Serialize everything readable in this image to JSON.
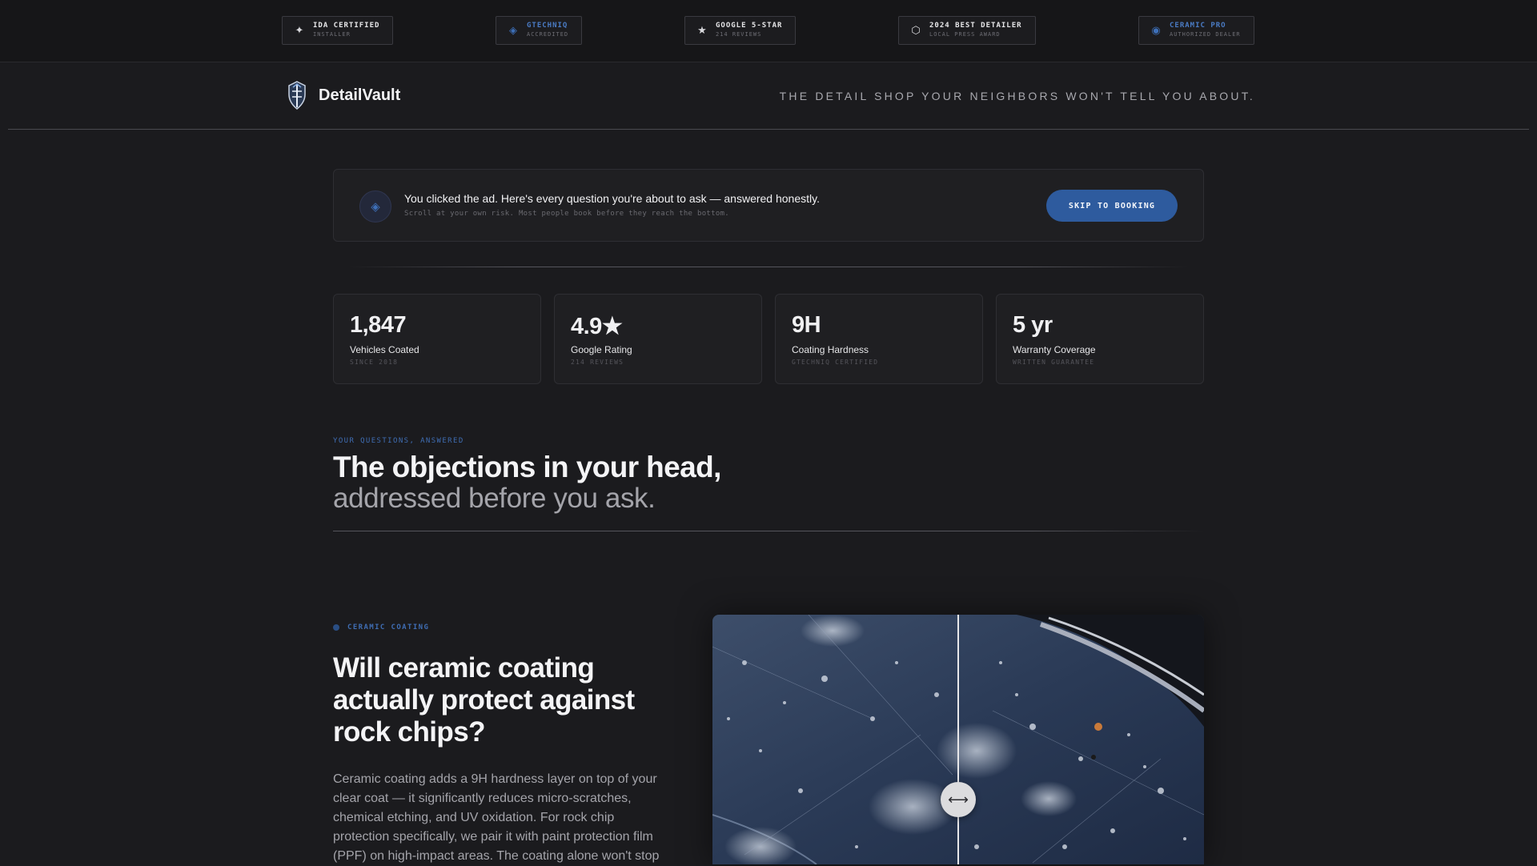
{
  "trust_badges": [
    {
      "icon": "sparkle-icon",
      "glyph": "✦",
      "title": "IDA CERTIFIED",
      "subtitle": "INSTALLER",
      "accent": false
    },
    {
      "icon": "diamond-icon",
      "glyph": "◈",
      "title": "GTECHNIQ",
      "subtitle": "ACCREDITED",
      "accent": true
    },
    {
      "icon": "star-icon",
      "glyph": "★",
      "title": "GOOGLE 5-STAR",
      "subtitle": "214 REVIEWS",
      "accent": false
    },
    {
      "icon": "hexagon-icon",
      "glyph": "⬡",
      "title": "2024 BEST DETAILER",
      "subtitle": "LOCAL PRESS AWARD",
      "accent": false
    },
    {
      "icon": "circle-icon",
      "glyph": "◉",
      "title": "CERAMIC PRO",
      "subtitle": "AUTHORIZED DEALER",
      "accent": true
    }
  ],
  "header": {
    "brand": "DetailVault",
    "tagline": "THE DETAIL SHOP YOUR NEIGHBORS WON'T TELL YOU ABOUT."
  },
  "banner": {
    "title": "You clicked the ad. Here's every question you're about to ask — answered honestly.",
    "subtitle": "Scroll at your own risk. Most people book before they reach the bottom.",
    "button": "SKIP TO BOOKING"
  },
  "stats": [
    {
      "value": "1,847",
      "label": "Vehicles Coated",
      "sub": "SINCE 2018"
    },
    {
      "value": "4.9★",
      "label": "Google Rating",
      "sub": "214 REVIEWS"
    },
    {
      "value": "9H",
      "label": "Coating Hardness",
      "sub": "GTECHNIQ CERTIFIED"
    },
    {
      "value": "5 yr",
      "label": "Warranty Coverage",
      "sub": "WRITTEN GUARANTEE"
    }
  ],
  "questions": {
    "eyebrow": "YOUR QUESTIONS, ANSWERED",
    "heading_line1": "The objections in your head,",
    "heading_line2": "addressed before you ask."
  },
  "ceramic": {
    "category": "CERAMIC COATING",
    "heading": "Will ceramic coating actually protect against rock chips?",
    "body": "Ceramic coating adds a 9H hardness layer on top of your clear coat — it significantly reduces micro-scratches, chemical etching, and UV oxidation. For rock chip protection specifically, we pair it with paint protection film (PPF) on high-impact areas. The coating alone won't stop"
  },
  "colors": {
    "background": "#1b1b1e",
    "accent": "#2e5b9e",
    "accent_text": "#3f6db3"
  }
}
